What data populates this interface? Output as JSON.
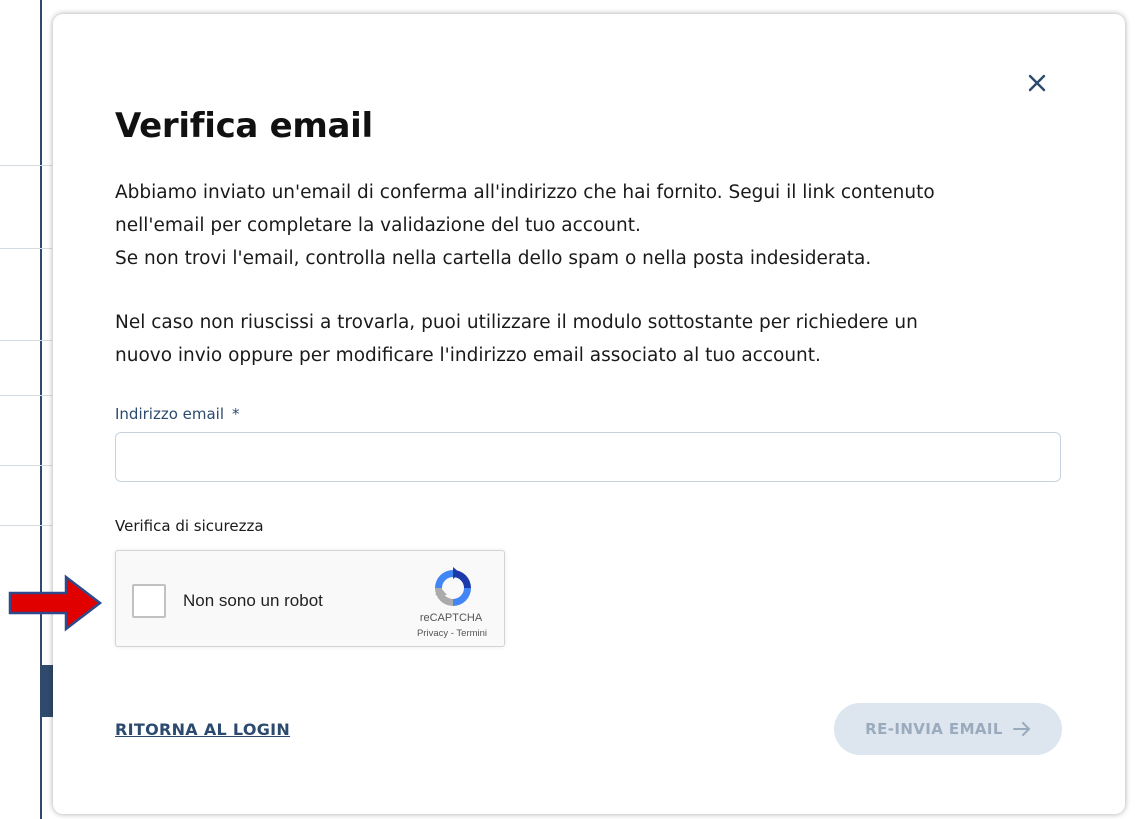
{
  "modal": {
    "title": "Verifica email",
    "paragraphs": [
      "Abbiamo inviato un'email di conferma all'indirizzo che hai fornito. Segui il link contenuto",
      "nell'email per completare la validazione del tuo account.",
      "Se non trovi l'email, controlla nella cartella dello spam o nella posta indesiderata.",
      "Nel caso non riuscissi a trovarla, puoi utilizzare il modulo sottostante per richiedere un",
      "nuovo invio oppure per modificare l'indirizzo email associato al tuo account."
    ],
    "email_field": {
      "label": "Indirizzo email",
      "required_marker": "*",
      "value": "",
      "placeholder": ""
    },
    "security": {
      "label": "Verifica di sicurezza",
      "recaptcha": {
        "label": "Non sono un robot",
        "brand": "reCAPTCHA",
        "privacy": "Privacy",
        "separator": " - ",
        "terms": "Termini"
      }
    },
    "back_link": "RITORNA AL LOGIN",
    "resend_button": "RE-INVIA EMAIL",
    "close_icon": "close-icon"
  },
  "colors": {
    "accent": "#2c4a6e",
    "button_disabled_bg": "#dde5ee",
    "button_disabled_text": "#9aabbe",
    "annotation_arrow": "#e00000"
  }
}
